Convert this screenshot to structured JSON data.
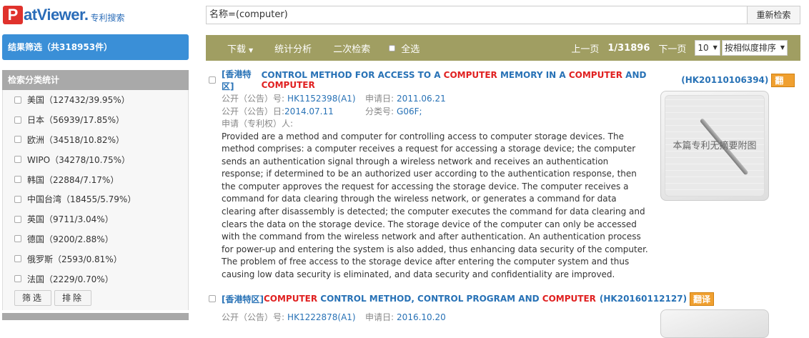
{
  "logo": {
    "mark": "P",
    "text": "atViewer.",
    "sub": "专利搜索"
  },
  "sidebar": {
    "filter_title": "结果筛选（共318953件）",
    "category_title": "检索分类统计",
    "items": [
      {
        "label": "美国（127432/39.95%）"
      },
      {
        "label": "日本（56939/17.85%）"
      },
      {
        "label": "欧洲（34518/10.82%）"
      },
      {
        "label": "WIPO（34278/10.75%）"
      },
      {
        "label": "韩国（22884/7.17%）"
      },
      {
        "label": "中国台湾（18455/5.79%）"
      },
      {
        "label": "英国（9711/3.04%）"
      },
      {
        "label": "德国（9200/2.88%）"
      },
      {
        "label": "俄罗斯（2593/0.81%）"
      },
      {
        "label": "法国（2229/0.70%）"
      }
    ],
    "filter_button": "筛选",
    "exclude_button": "排除"
  },
  "search": {
    "value": "名称=(computer)",
    "button": "重新检索"
  },
  "toolbar": {
    "download": "下载",
    "stats": "统计分析",
    "second_search": "二次检索",
    "select_all": "全选",
    "prev": "上一页",
    "page": "1/31896",
    "next": "下一页",
    "page_size": "10",
    "sort": "按相似度排序"
  },
  "results": [
    {
      "region": "[香港特区]",
      "title_parts": [
        {
          "t": "CONTROL METHOD FOR ACCESS TO A ",
          "c": "blue"
        },
        {
          "t": "COMPUTER",
          "c": "red"
        },
        {
          "t": " MEMORY IN A ",
          "c": "blue"
        },
        {
          "t": "COMPUTER",
          "c": "red"
        },
        {
          "t": " AND ",
          "c": "blue"
        },
        {
          "t": "COMPUTER",
          "c": "red"
        }
      ],
      "number": "(HK20110106394)",
      "translate": "翻译",
      "pub_no_label": "公开（公告）号:",
      "pub_no": "HK1152398(A1)",
      "app_date_label": "申请日:",
      "app_date": "2011.06.21",
      "pub_date_label": "公开（公告）日:",
      "pub_date": "2014.07.11",
      "class_label": "分类号:",
      "class": "G06F;",
      "applicant_label": "申请（专利权）人:",
      "abstract": "Provided are a method and computer for controlling access to computer storage devices. The method comprises: a computer receives a request for accessing a storage device; the computer sends an authentication signal through a wireless network and receives an authentication response; if determined to be an authorized user according to the authentication response, then the computer approves the request for accessing the storage device. The computer receives a command for data clearing through the wireless network, or generates a command for data clearing after disassembly is detected; the computer executes the command for data clearing and clears the data on the storage device. The storage device of the computer can only be accessed with the command from the wireless network and after authentication. An authentication process for power-up and entering the system is also added, thus enhancing data security of the computer. The problem of free access to the storage device after entering the computer system and thus causing low data security is eliminated, and data security and confidentiality are improved.",
      "thumb_text": "本篇专利无摘要附图"
    },
    {
      "region": "[香港特区]",
      "title_parts": [
        {
          "t": "COMPUTER",
          "c": "red"
        },
        {
          "t": " CONTROL METHOD, CONTROL PROGRAM AND ",
          "c": "blue"
        },
        {
          "t": "COMPUTER",
          "c": "red"
        }
      ],
      "number": "(HK20160112127)",
      "translate": "翻译",
      "pub_no_label": "公开（公告）号:",
      "pub_no": "HK1222878(A1)",
      "app_date_label": "申请日:",
      "app_date": "2016.10.20"
    }
  ]
}
